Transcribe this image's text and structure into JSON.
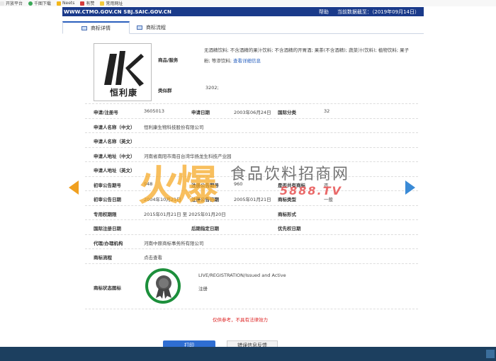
{
  "bookmarks": [
    {
      "label": "开放平台",
      "color": "#e8e8e8"
    },
    {
      "label": "千图下载",
      "color": "#3aa857"
    },
    {
      "label": "Neets",
      "color": "#f3b71a"
    },
    {
      "label": "有赞",
      "color": "#d43c3c"
    },
    {
      "label": "常用网址",
      "color": "#f3c93c"
    }
  ],
  "header": {
    "url": "WWW.CTMO.GOV.CN SBJ.SAIC.GOV.CN",
    "help": "帮助",
    "date": "当前数据截至：（2019年09月14日）"
  },
  "tabs": [
    {
      "label": "商标详情",
      "active": true
    },
    {
      "label": "商标流程",
      "active": false
    }
  ],
  "trademark": {
    "logo_text": "恒利康",
    "goods_label": "商品/服务",
    "goods_value": "无酒精饮料; 不含酒精的果汁饮料; 不含酒精的开胃酒; 果茶(不含酒精); 蔬菜汁(饮料); 植物饮料; 果子粉; 等渗饮料;",
    "goods_link": "查看详细信息",
    "group_label": "类似群",
    "group_value": "3202;"
  },
  "rows": [
    {
      "l1": "申请/注册号",
      "v1": "3605013",
      "l2": "申请日期",
      "v2": "2003年06月24日",
      "l3": "国际分类",
      "v3": "32"
    },
    {
      "l1": "申请人名称（中文）",
      "v1": "恒利康生物科技股份有限公司"
    },
    {
      "l1": "申请人名称（英文）",
      "v1": ""
    },
    {
      "l1": "申请人地址（中文）",
      "v1": "河南省南阳市南召台湾华扬龙生科技产业园"
    },
    {
      "l1": "申请人地址（英文）",
      "v1": ""
    },
    {
      "l1": "初审公告期号",
      "v1": "948",
      "l2": "注册公告期号",
      "v2": "960",
      "l3": "是否共有商标",
      "v3": "否"
    },
    {
      "l1": "初审公告日期",
      "v1": "2004年10月21日",
      "l2": "注册公告日期",
      "v2": "2005年01月21日",
      "l3": "商标类型",
      "v3": "一般"
    },
    {
      "l1": "专用权期限",
      "v1": "2015年01月21日 至 2025年01月20日",
      "l3": "商标形式",
      "v3": ""
    },
    {
      "l1": "国际注册日期",
      "v1": "",
      "l2": "后期指定日期",
      "v2": "",
      "l3": "优先权日期",
      "v3": ""
    },
    {
      "l1": "代理/办理机构",
      "v1": "河南中原商标事务所有限公司"
    },
    {
      "l1": "商标流程",
      "v1": "点击查看"
    }
  ],
  "status": {
    "label": "商标状态图标",
    "english": "LIVE/REGISTRATION/Issued and Active",
    "chinese": "注册"
  },
  "notice": "仅供参考，不具有法律效力",
  "buttons": {
    "print": "打印",
    "report": "错误信息反馈"
  },
  "watermark": {
    "big": "火爆",
    "title": "食品饮料招商网",
    "sub": "5888.TV"
  }
}
